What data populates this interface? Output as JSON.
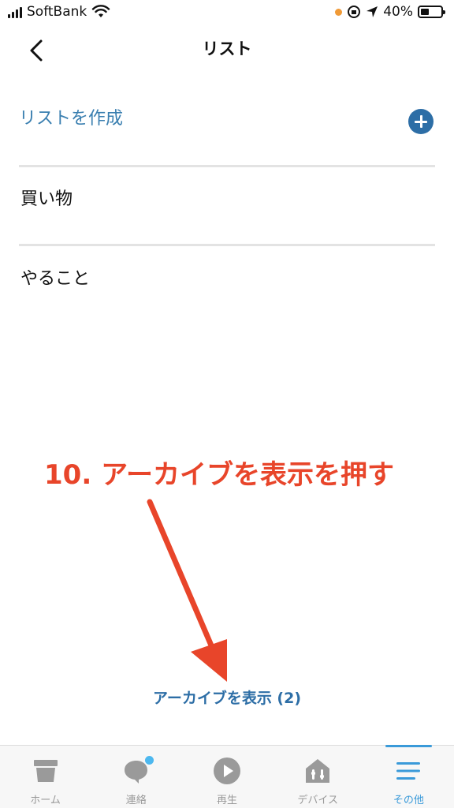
{
  "status_bar": {
    "carrier": "SoftBank",
    "battery": "40%",
    "battery_level": 0.4
  },
  "header": {
    "title": "リスト"
  },
  "create": {
    "label": "リストを作成"
  },
  "lists": [
    {
      "label": "買い物"
    },
    {
      "label": "やること"
    }
  ],
  "annotation": {
    "text": "10. アーカイブを表示を押す",
    "color": "#e8452a"
  },
  "archive_link": "アーカイブを表示 (2)",
  "tabs": [
    {
      "label": "ホーム",
      "icon": "home-icon"
    },
    {
      "label": "連絡",
      "icon": "chat-bubble-icon"
    },
    {
      "label": "再生",
      "icon": "play-icon"
    },
    {
      "label": "デバイス",
      "icon": "smart-home-icon"
    },
    {
      "label": "その他",
      "icon": "menu-icon",
      "active": true
    }
  ],
  "colors": {
    "accent": "#2d6ea6",
    "link": "#3a7fb0",
    "tab_active": "#3a9ad9",
    "badge": "#4db8ef"
  }
}
